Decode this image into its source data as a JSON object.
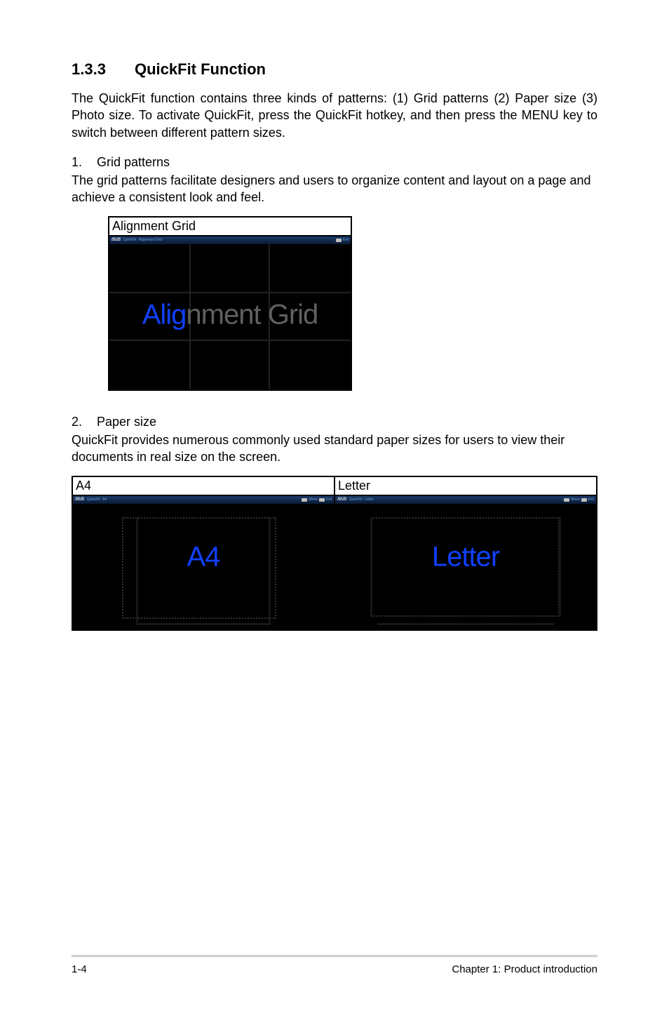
{
  "heading": {
    "number": "1.3.3",
    "title": "QuickFit Function"
  },
  "intro": "The QuickFit function contains three kinds of patterns: (1) Grid patterns (2) Paper size (3) Photo size. To activate QuickFit, press the QuickFit hotkey, and then press the MENU key to switch between different pattern sizes.",
  "sections": [
    {
      "num": "1.",
      "title": "Grid patterns",
      "text": "The grid patterns facilitate designers and users to organize content and layout on a page and achieve a consistent look and feel."
    },
    {
      "num": "2.",
      "title": "Paper size",
      "text": "QuickFit provides numerous commonly used standard paper sizes for users to view their documents in real size on the screen."
    }
  ],
  "fig_alignment": {
    "label": "Alignment Grid",
    "osd_brand": "/SUS",
    "osd_text": "QuickFit : Alignment Grid",
    "osd_exit": "Exit",
    "overlay_a": "Alig",
    "overlay_b": "nment",
    "overlay_c": " Grid"
  },
  "fig_paper": {
    "a4": {
      "label": "A4",
      "osd_brand": "/SUS",
      "osd_text": "QuickFit : A4",
      "osd_move": "Move",
      "osd_exit": "Exit",
      "overlay": "A4"
    },
    "letter": {
      "label": "Letter",
      "osd_brand": "/SUS",
      "osd_text": "QuickFit : Letter",
      "osd_move": "Move",
      "osd_exit": "Exit",
      "overlay": "Letter"
    }
  },
  "footer": {
    "left": "1-4",
    "right": "Chapter 1: Product introduction"
  }
}
